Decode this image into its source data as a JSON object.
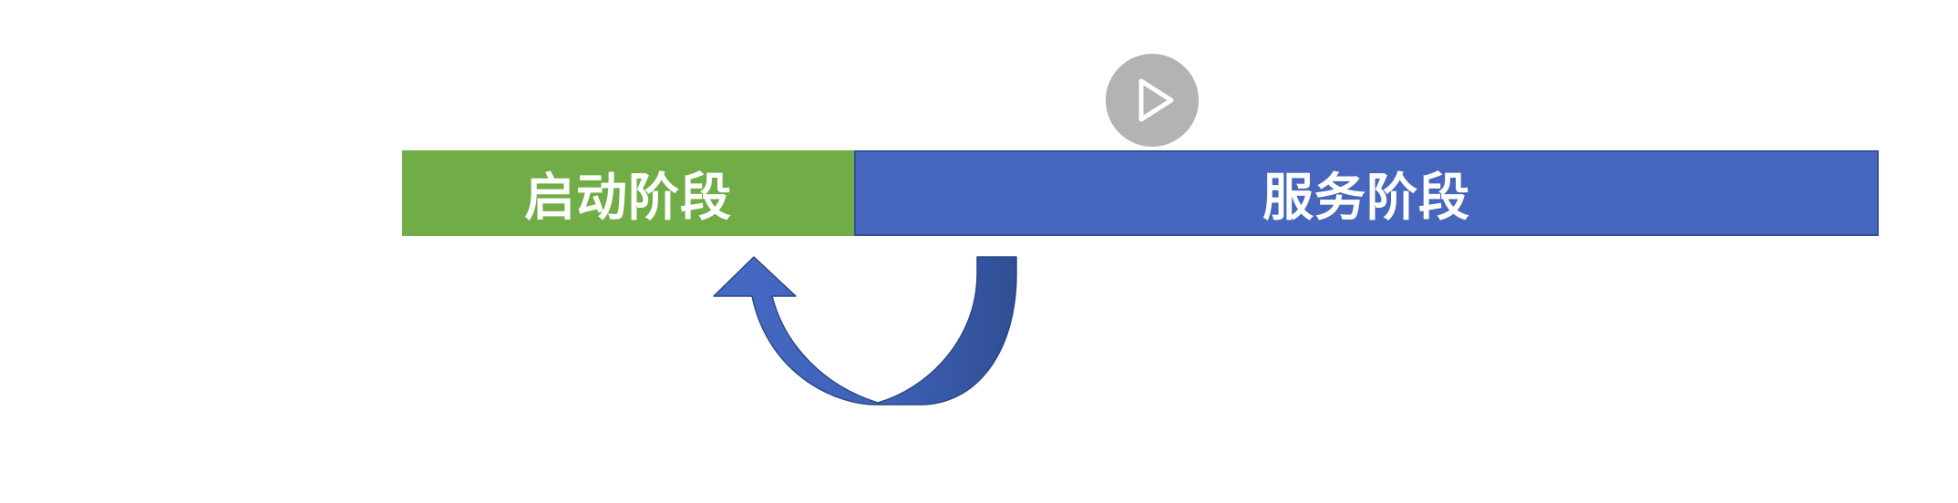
{
  "phases": {
    "startup": {
      "label": "启动阶段",
      "color": "#70ad47"
    },
    "service": {
      "label": "服务阶段",
      "color": "#4766bd"
    }
  },
  "controls": {
    "play_icon": "play-icon"
  },
  "loop_arrow": {
    "icon": "curved-return-arrow",
    "color": "#3d5fb5"
  }
}
